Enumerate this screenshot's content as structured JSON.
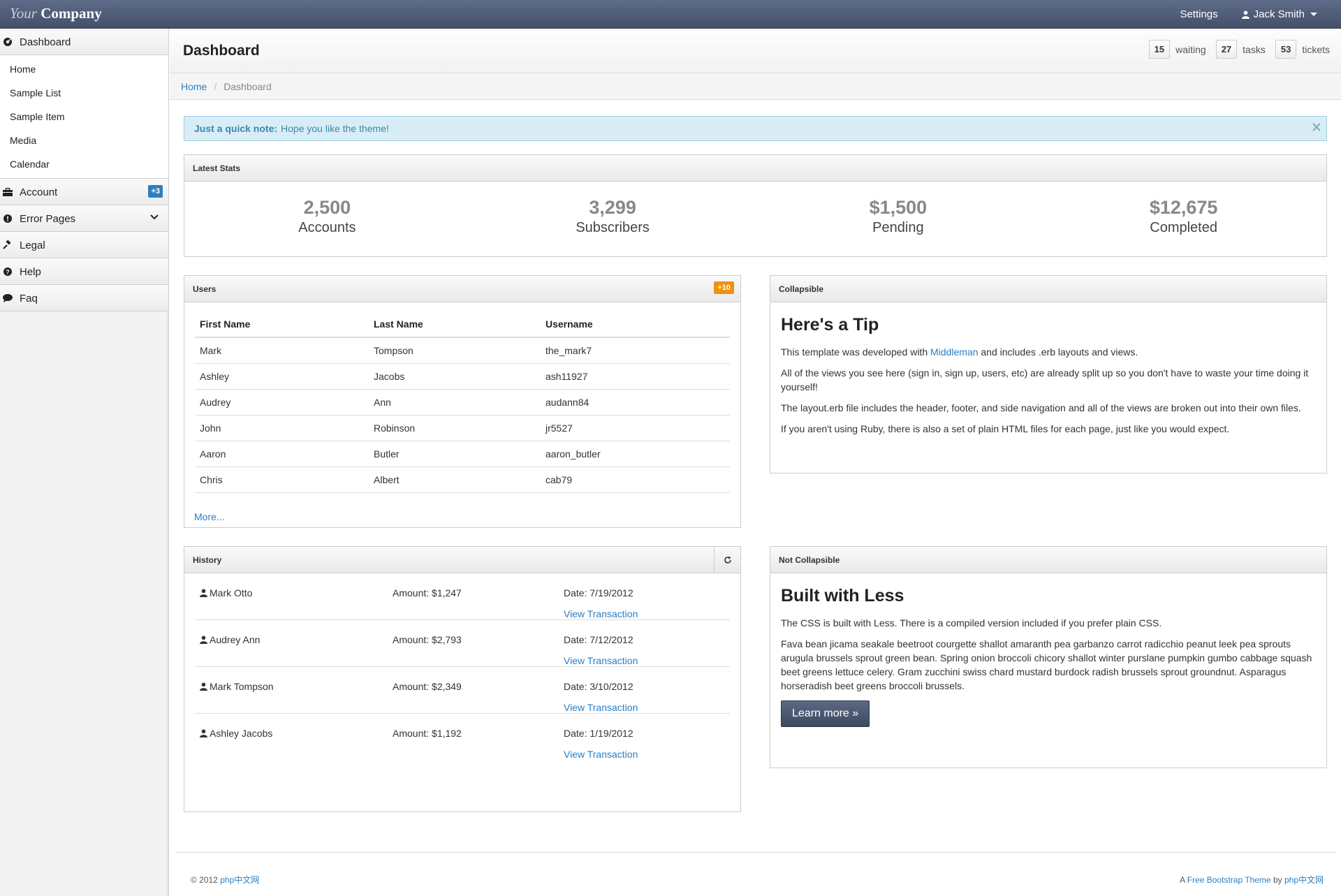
{
  "header": {
    "brand_italic": "Your",
    "brand_bold": "Company",
    "settings_label": "Settings",
    "user_name": "Jack Smith"
  },
  "sidebar": {
    "dashboard": "Dashboard",
    "sub_items": [
      "Home",
      "Sample List",
      "Sample Item",
      "Media",
      "Calendar"
    ],
    "account": "Account",
    "account_badge": "+3",
    "error_pages": "Error Pages",
    "legal": "Legal",
    "help": "Help",
    "faq": "Faq"
  },
  "page": {
    "title": "Dashboard",
    "counters": [
      {
        "value": "15",
        "label": "waiting"
      },
      {
        "value": "27",
        "label": "tasks"
      },
      {
        "value": "53",
        "label": "tickets"
      }
    ],
    "breadcrumb_home": "Home",
    "breadcrumb_current": "Dashboard"
  },
  "alert": {
    "strong": "Just a quick note:",
    "text": "Hope you like the theme!"
  },
  "stats": {
    "title": "Latest Stats",
    "items": [
      {
        "value": "2,500",
        "label": "Accounts"
      },
      {
        "value": "3,299",
        "label": "Subscribers"
      },
      {
        "value": "$1,500",
        "label": "Pending"
      },
      {
        "value": "$12,675",
        "label": "Completed"
      }
    ]
  },
  "users": {
    "title": "Users",
    "badge": "+10",
    "columns": [
      "First Name",
      "Last Name",
      "Username"
    ],
    "rows": [
      [
        "Mark",
        "Tompson",
        "the_mark7"
      ],
      [
        "Ashley",
        "Jacobs",
        "ash11927"
      ],
      [
        "Audrey",
        "Ann",
        "audann84"
      ],
      [
        "John",
        "Robinson",
        "jr5527"
      ],
      [
        "Aaron",
        "Butler",
        "aaron_butler"
      ],
      [
        "Chris",
        "Albert",
        "cab79"
      ]
    ],
    "more": "More..."
  },
  "collapsible": {
    "title": "Collapsible",
    "heading": "Here's a Tip",
    "p1_before": "This template was developed with",
    "p1_link": "Middleman",
    "p1_after": "and includes .erb layouts and views.",
    "p2": "All of the views you see here (sign in, sign up, users, etc) are already split up so you don't have to waste your time doing it yourself!",
    "p3": "The layout.erb file includes the header, footer, and side navigation and all of the views are broken out into their own files.",
    "p4": "If you aren't using Ruby, there is also a set of plain HTML files for each page, just like you would expect."
  },
  "history": {
    "title": "History",
    "rows": [
      {
        "name": "Mark Otto",
        "amount": "Amount: $1,247",
        "date": "Date: 7/19/2012",
        "link": "View Transaction"
      },
      {
        "name": "Audrey Ann",
        "amount": "Amount: $2,793",
        "date": "Date: 7/12/2012",
        "link": "View Transaction"
      },
      {
        "name": "Mark Tompson",
        "amount": "Amount: $2,349",
        "date": "Date: 3/10/2012",
        "link": "View Transaction"
      },
      {
        "name": "Ashley Jacobs",
        "amount": "Amount: $1,192",
        "date": "Date: 1/19/2012",
        "link": "View Transaction"
      }
    ]
  },
  "notcollapsible": {
    "title": "Not Collapsible",
    "heading": "Built with Less",
    "p1": "The CSS is built with Less. There is a compiled version included if you prefer plain CSS.",
    "p2": "Fava bean jicama seakale beetroot courgette shallot amaranth pea garbanzo carrot radicchio peanut leek pea sprouts arugula brussels sprout green bean. Spring onion broccoli chicory shallot winter purslane pumpkin gumbo cabbage squash beet greens lettuce celery. Gram zucchini swiss chard mustard burdock radish brussels sprout groundnut. Asparagus horseradish beet greens broccoli brussels.",
    "button": "Learn more »"
  },
  "footer": {
    "copyright": "© 2012",
    "copyright_link": "php中文网",
    "right_prefix": "A",
    "right_link": "Free Bootstrap Theme",
    "right_mid": "by",
    "right_link2": "php中文网"
  }
}
